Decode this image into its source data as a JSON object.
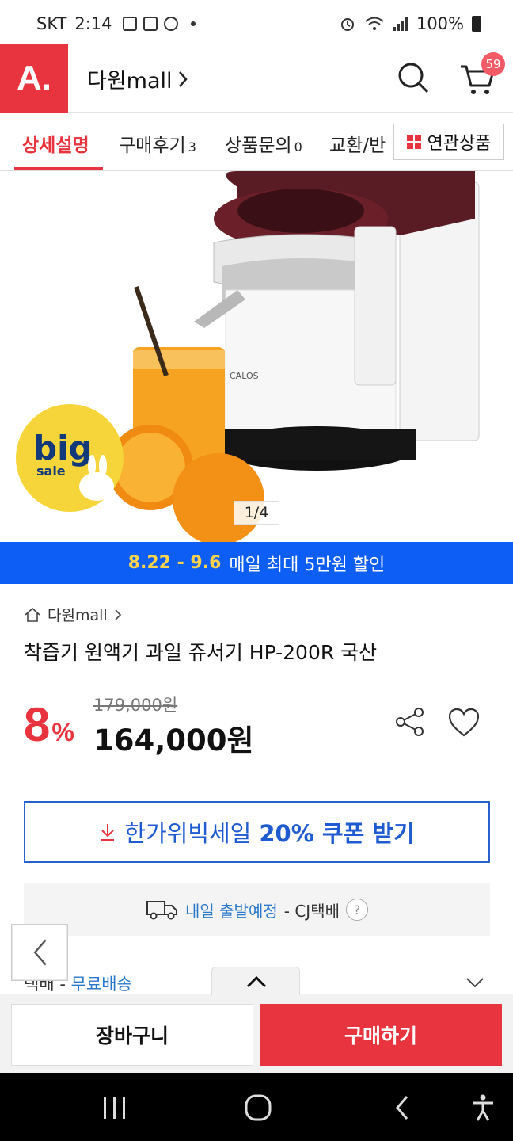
{
  "status_bar": {
    "carrier": "SKT",
    "time": "2:14",
    "battery": "100%"
  },
  "header": {
    "logo": "A.",
    "store_name": "다원mall",
    "cart_count": "59"
  },
  "tabs": [
    {
      "label": "상세설명",
      "count": ""
    },
    {
      "label": "구매후기",
      "count": "3"
    },
    {
      "label": "상품문의",
      "count": "0"
    },
    {
      "label": "교환/반",
      "count": ""
    }
  ],
  "related_button": "연관상품",
  "hero": {
    "counter": "1/4",
    "badge_big": "big",
    "badge_sale": "sale",
    "brand_text": "CALOS"
  },
  "sale_banner": {
    "dates": "8.22 - 9.6",
    "text": "매일 최대 5만원 할인"
  },
  "product": {
    "breadcrumb": "다원mall",
    "title": "착즙기 원액기 과일 쥬서기 HP-200R 국산",
    "discount_num": "8",
    "discount_unit": "%",
    "original_price": "179,000원",
    "sale_price": "164,000원"
  },
  "coupon": {
    "prefix": "한가위빅세일",
    "bold": "20% 쿠폰 받기"
  },
  "shipping": {
    "highlight": "내일 출발예정",
    "carrier": "- CJ택배",
    "help": "?"
  },
  "delivery": {
    "prefix": "택배 - ",
    "free": "무료배송"
  },
  "bottom": {
    "cart": "장바구니",
    "buy": "구매하기"
  },
  "colors": {
    "brand_red": "#e8343e",
    "banner_blue": "#0d5ef4",
    "coupon_blue": "#1f5bd0"
  }
}
